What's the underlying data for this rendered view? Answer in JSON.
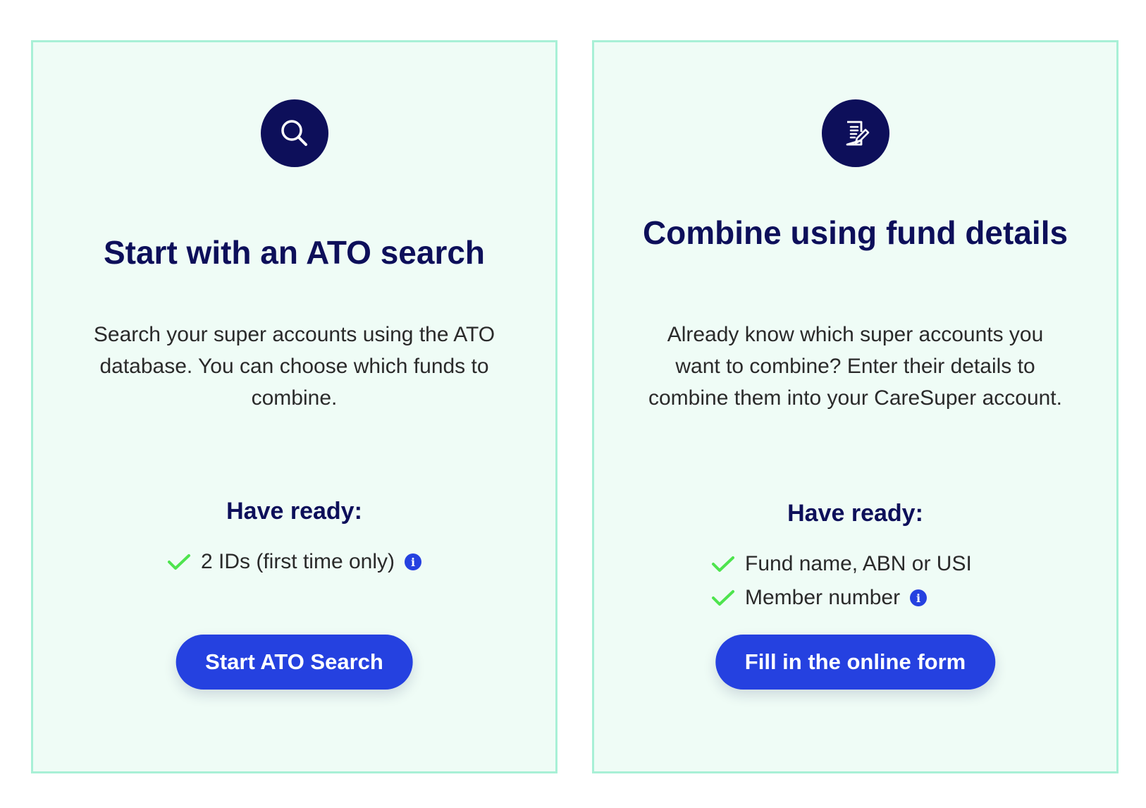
{
  "colors": {
    "card_background": "#effcf6",
    "card_border": "#a8f0d6",
    "navy": "#0d0f5a",
    "button_blue": "#2541e0",
    "check_green": "#4ee44e"
  },
  "cards": [
    {
      "icon": "search-icon",
      "title": "Start with an ATO search",
      "description": "Search your super accounts using the ATO database. You can choose which funds to combine.",
      "ready_heading": "Have ready:",
      "ready_items": [
        {
          "label": "2 IDs (first time only)",
          "info": true
        }
      ],
      "button_label": "Start ATO Search"
    },
    {
      "icon": "document-edit-icon",
      "title": "Combine using fund details",
      "description": "Already know which super accounts you want to combine? Enter their details to combine them into your CareSuper account.",
      "ready_heading": "Have ready:",
      "ready_items": [
        {
          "label": "Fund name, ABN or USI",
          "info": false
        },
        {
          "label": "Member number",
          "info": true
        }
      ],
      "button_label": "Fill in the online form"
    }
  ]
}
